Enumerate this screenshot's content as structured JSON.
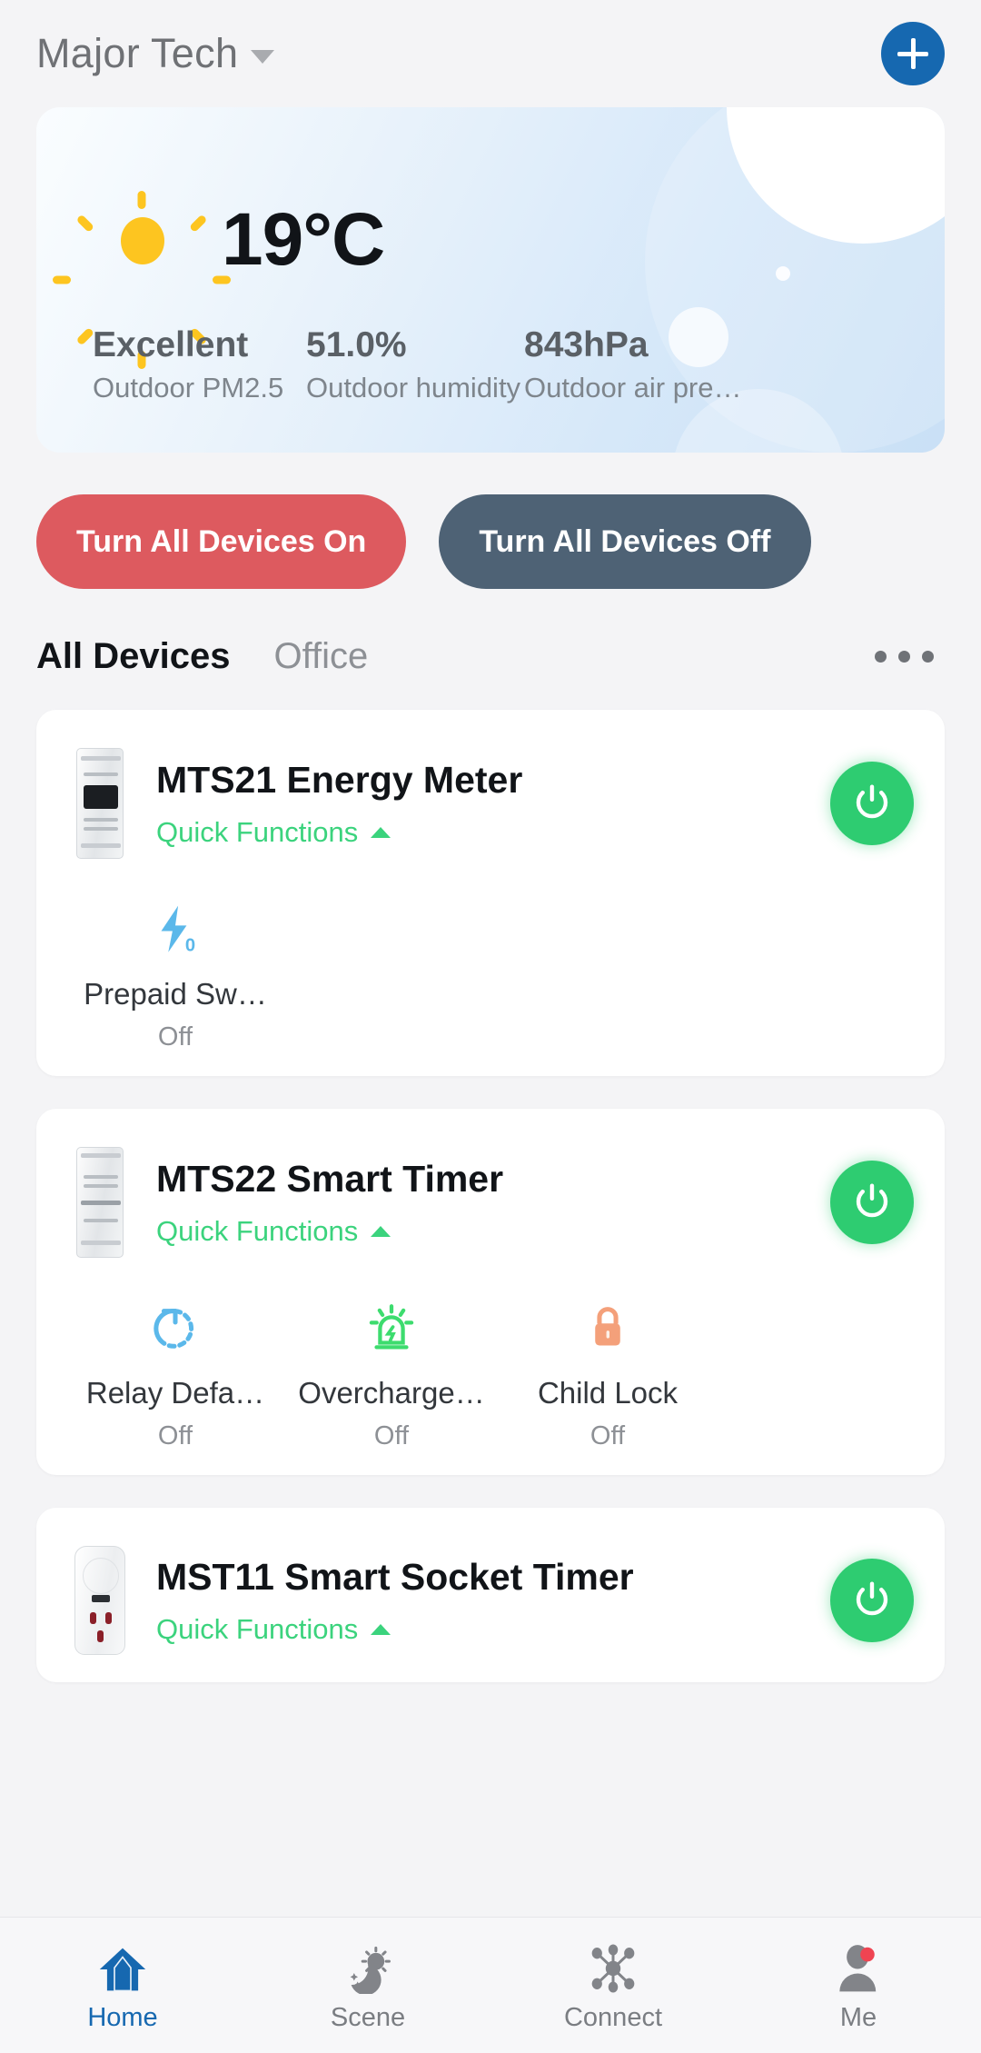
{
  "header": {
    "home_name": "Major Tech",
    "dropdown_icon": "chevron-down-icon",
    "add_icon": "plus-icon"
  },
  "weather": {
    "icon": "sun-icon",
    "temperature": "19°C",
    "stats": [
      {
        "value": "Excellent",
        "label": "Outdoor PM2.5"
      },
      {
        "value": "51.0%",
        "label": "Outdoor humidity"
      },
      {
        "value": "843hPa",
        "label": "Outdoor air pres…"
      }
    ]
  },
  "bulk_actions": {
    "on_label": "Turn All Devices On",
    "off_label": "Turn All Devices Off",
    "on_color": "#dd5a5f",
    "off_color": "#4e6275"
  },
  "tabs": {
    "items": [
      {
        "label": "All Devices",
        "active": true
      },
      {
        "label": "Office",
        "active": false
      }
    ],
    "more_icon": "more-horizontal-icon"
  },
  "devices": [
    {
      "title": "MTS21 Energy Meter",
      "quick_functions_label": "Quick Functions",
      "quick_functions_caret": "chevron-up-icon",
      "power_state": "on",
      "power_icon": "power-icon",
      "thumb": "din-rail-meter",
      "functions": [
        {
          "icon": "lightning-zero-icon",
          "name": "Prepaid Sw…",
          "state": "Off",
          "color": "#5bb8ea"
        }
      ]
    },
    {
      "title": "MTS22 Smart Timer",
      "quick_functions_label": "Quick Functions",
      "quick_functions_caret": "chevron-up-icon",
      "power_state": "on",
      "power_icon": "power-icon",
      "thumb": "din-rail-timer",
      "functions": [
        {
          "icon": "restore-arrow-icon",
          "name": "Relay Defa…",
          "state": "Off",
          "color": "#5bb8ea"
        },
        {
          "icon": "overcharge-alarm-icon",
          "name": "Overcharge…",
          "state": "Off",
          "color": "#3ddc6e"
        },
        {
          "icon": "lock-icon",
          "name": "Child Lock",
          "state": "Off",
          "color": "#f4a07a"
        }
      ]
    },
    {
      "title": "MST11 Smart Socket Timer",
      "quick_functions_label": "Quick Functions",
      "quick_functions_caret": "chevron-up-icon",
      "power_state": "on",
      "power_icon": "power-icon",
      "thumb": "plug-socket",
      "functions": []
    }
  ],
  "bottom_nav": [
    {
      "label": "Home",
      "icon": "house-icon",
      "active": true
    },
    {
      "label": "Scene",
      "icon": "scene-moon-sun-icon",
      "active": false
    },
    {
      "label": "Connect",
      "icon": "network-hub-icon",
      "active": false
    },
    {
      "label": "Me",
      "icon": "person-icon",
      "active": false,
      "badge": true
    }
  ],
  "colors": {
    "accent_blue": "#1668b0",
    "power_green": "#2ecc71",
    "quick_green": "#3bd37d"
  }
}
